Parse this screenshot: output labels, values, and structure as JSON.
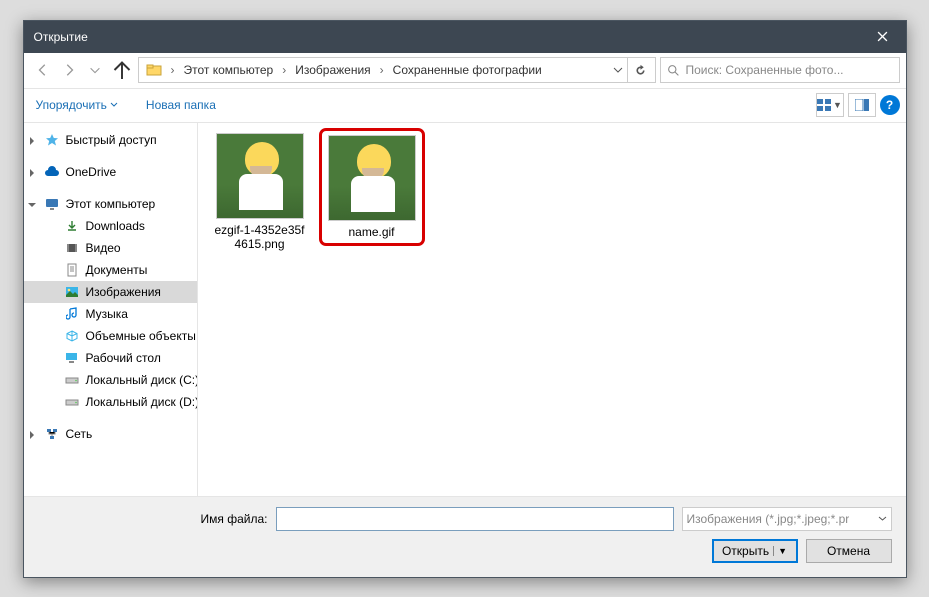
{
  "title": "Открытие",
  "breadcrumbs": [
    "Этот компьютер",
    "Изображения",
    "Сохраненные фотографии"
  ],
  "search_placeholder": "Поиск: Сохраненные фото...",
  "toolbar": {
    "organize": "Упорядочить",
    "new_folder": "Новая папка"
  },
  "sidebar": {
    "quick_access": "Быстрый доступ",
    "onedrive": "OneDrive",
    "this_pc": "Этот компьютер",
    "downloads": "Downloads",
    "videos": "Видео",
    "documents": "Документы",
    "pictures": "Изображения",
    "music": "Музыка",
    "objects3d": "Объемные объекты",
    "desktop": "Рабочий стол",
    "local_disk_c": "Локальный диск (C:)",
    "local_disk_d": "Локальный диск (D:)",
    "network": "Сеть"
  },
  "files": [
    {
      "name": "ezgif-1-4352e35f4615.png",
      "selected": false
    },
    {
      "name": "name.gif",
      "selected": true
    }
  ],
  "filename_label": "Имя файла:",
  "filename_value": "",
  "filetype": "Изображения (*.jpg;*.jpeg;*.pr",
  "buttons": {
    "open": "Открыть",
    "cancel": "Отмена"
  }
}
